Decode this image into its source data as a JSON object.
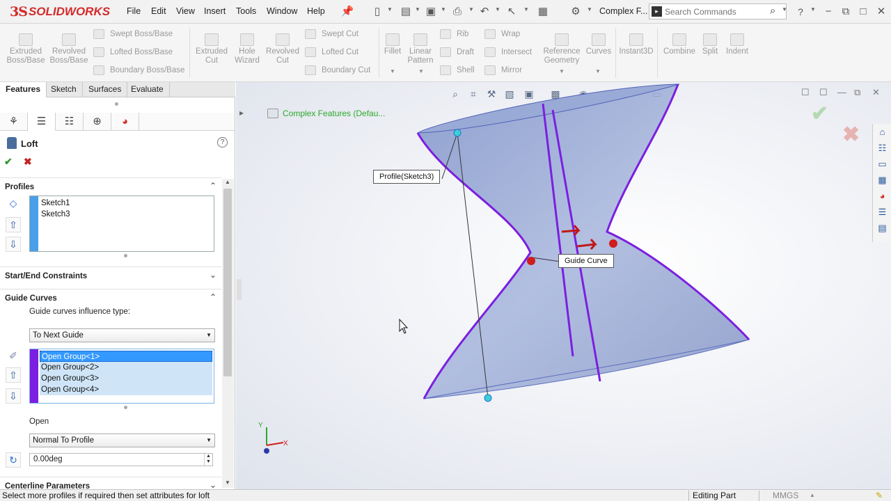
{
  "app": {
    "logo": "SOLIDWORKS",
    "logo_mark": "3S",
    "menu": [
      "File",
      "Edit",
      "View",
      "Insert",
      "Tools",
      "Window",
      "Help"
    ],
    "document_title": "Complex F...",
    "search_placeholder": "Search Commands"
  },
  "commands": {
    "extruded_boss": "Extruded Boss/Base",
    "revolved_boss": "Revolved Boss/Base",
    "swept_boss": "Swept Boss/Base",
    "lofted_boss": "Lofted Boss/Base",
    "boundary_boss": "Boundary Boss/Base",
    "extruded_cut": "Extruded Cut",
    "hole_wizard": "Hole Wizard",
    "revolved_cut": "Revolved Cut",
    "swept_cut": "Swept Cut",
    "lofted_cut": "Lofted Cut",
    "boundary_cut": "Boundary Cut",
    "fillet": "Fillet",
    "linear_pattern": "Linear Pattern",
    "rib": "Rib",
    "draft": "Draft",
    "shell": "Shell",
    "wrap": "Wrap",
    "intersect": "Intersect",
    "mirror": "Mirror",
    "reference_geometry": "Reference Geometry",
    "curves": "Curves",
    "instant3d": "Instant3D",
    "combine": "Combine",
    "split": "Split",
    "indent": "Indent"
  },
  "tabs": [
    "Features",
    "Sketch",
    "Surfaces",
    "Evaluate"
  ],
  "property_manager": {
    "title": "Loft",
    "profiles": {
      "header": "Profiles",
      "items": [
        "Sketch1",
        "Sketch3"
      ]
    },
    "start_end": {
      "header": "Start/End Constraints"
    },
    "guide_curves": {
      "header": "Guide Curves",
      "influence_label": "Guide curves influence type:",
      "influence_value": "To Next Guide",
      "items": [
        "Open Group<1>",
        "Open Group<2>",
        "Open Group<3>",
        "Open Group<4>"
      ],
      "open_label": "Open",
      "tangency_value": "Normal To Profile",
      "angle_value": "0.00deg"
    },
    "centerline": {
      "header": "Centerline Parameters"
    }
  },
  "viewport": {
    "tree_item": "Complex Features  (Defau...",
    "callout_profile": "Profile(Sketch3)",
    "callout_guide": "Guide Curve",
    "triad_x": "X",
    "triad_y": "Y"
  },
  "status": {
    "message": "Select more profiles if required then set attributes for loft",
    "mode": "Editing Part",
    "units": "MMGS"
  },
  "colors": {
    "brand": "#d42a2a",
    "selection": "#3399ff",
    "guide_curve": "#7b1fe0",
    "profile_strip": "#4a9fe8",
    "ok_green": "#2d9a2d"
  }
}
